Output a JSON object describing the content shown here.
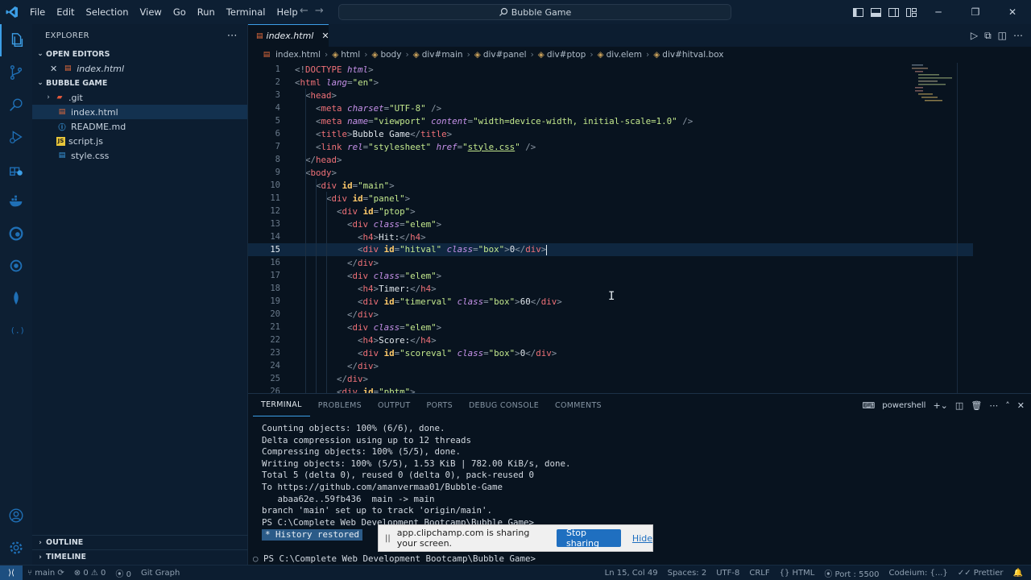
{
  "menu": [
    "File",
    "Edit",
    "Selection",
    "View",
    "Go",
    "Run",
    "Terminal",
    "Help"
  ],
  "command_center": "Bubble Game",
  "explorer": {
    "title": "EXPLORER",
    "open_editors_label": "OPEN EDITORS",
    "open_editor_file": "index.html",
    "workspace_label": "BUBBLE GAME",
    "files": [
      ".git",
      "index.html",
      "README.md",
      "script.js",
      "style.css"
    ],
    "outline_label": "OUTLINE",
    "timeline_label": "TIMELINE"
  },
  "tab": {
    "label": "index.html",
    "close": "✕"
  },
  "breadcrumb": [
    "index.html",
    "html",
    "body",
    "div#main",
    "div#panel",
    "div#ptop",
    "div.elem",
    "div#hitval.box"
  ],
  "editor": {
    "line_numbers": [
      "1",
      "2",
      "3",
      "4",
      "5",
      "6",
      "7",
      "8",
      "9",
      "10",
      "11",
      "12",
      "13",
      "14",
      "15",
      "16",
      "17",
      "18",
      "19",
      "20",
      "21",
      "22",
      "23",
      "24",
      "25",
      "26"
    ],
    "current_line": 15
  },
  "panel": {
    "tabs": [
      "TERMINAL",
      "PROBLEMS",
      "OUTPUT",
      "PORTS",
      "DEBUG CONSOLE",
      "COMMENTS"
    ],
    "shell": "powershell",
    "terminal_lines": [
      "Counting objects: 100% (6/6), done.",
      "Delta compression using up to 12 threads",
      "Compressing objects: 100% (5/5), done.",
      "Writing objects: 100% (5/5), 1.53 KiB | 782.00 KiB/s, done.",
      "Total 5 (delta 0), reused 0 (delta 0), pack-reused 0",
      "To https://github.com/amanvermaa01/Bubble-Game",
      "   abaa62e..59fb436  main -> main",
      "branch 'main' set up to track 'origin/main'.",
      "PS C:\\Complete Web Development Bootcamp\\Bubble Game>"
    ],
    "history_restored": "*  History restored",
    "prompt": "PS C:\\Complete Web Development Bootcamp\\Bubble Game>"
  },
  "share_bar": {
    "pause": "||",
    "message": "app.clipchamp.com is sharing your screen.",
    "stop": "Stop sharing",
    "hide": "Hide"
  },
  "status": {
    "branch": "main",
    "errors": "0",
    "warnings": "0",
    "ports": "0",
    "git_graph": "Git Graph",
    "position": "Ln 15, Col 49",
    "spaces": "Spaces: 2",
    "encoding": "UTF-8",
    "eol": "CRLF",
    "language": "HTML",
    "port": "Port : 5500",
    "codeium": "Codeium: {...}",
    "prettier": "Prettier"
  }
}
